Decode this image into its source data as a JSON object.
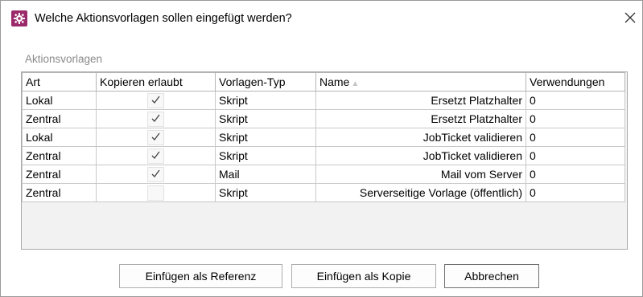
{
  "dialog": {
    "title": "Welche Aktionsvorlagen sollen eingefügt werden?",
    "icon": "gear-icon",
    "accent_color": "#9b2a6b"
  },
  "group": {
    "label": "Aktionsvorlagen"
  },
  "table": {
    "columns": [
      "Art",
      "Kopieren erlaubt",
      "Vorlagen-Typ",
      "Name",
      "Verwendungen"
    ],
    "sort_column": "Name",
    "sort_indicator": "▲",
    "rows": [
      {
        "art": "Lokal",
        "copy_allowed": true,
        "type": "Skript",
        "name": "Ersetzt Platzhalter",
        "usages": "0"
      },
      {
        "art": "Zentral",
        "copy_allowed": true,
        "type": "Skript",
        "name": "Ersetzt Platzhalter",
        "usages": "0"
      },
      {
        "art": "Lokal",
        "copy_allowed": true,
        "type": "Skript",
        "name": "JobTicket validieren",
        "usages": "0"
      },
      {
        "art": "Zentral",
        "copy_allowed": true,
        "type": "Skript",
        "name": "JobTicket validieren",
        "usages": "0"
      },
      {
        "art": "Zentral",
        "copy_allowed": true,
        "type": "Mail",
        "name": "Mail vom Server",
        "usages": "0"
      },
      {
        "art": "Zentral",
        "copy_allowed": false,
        "type": "Skript",
        "name": "Serverseitige Vorlage (öffentlich)",
        "usages": "0"
      }
    ]
  },
  "buttons": {
    "insert_reference": "Einfügen als Referenz",
    "insert_copy": "Einfügen als Kopie",
    "cancel": "Abbrechen"
  }
}
